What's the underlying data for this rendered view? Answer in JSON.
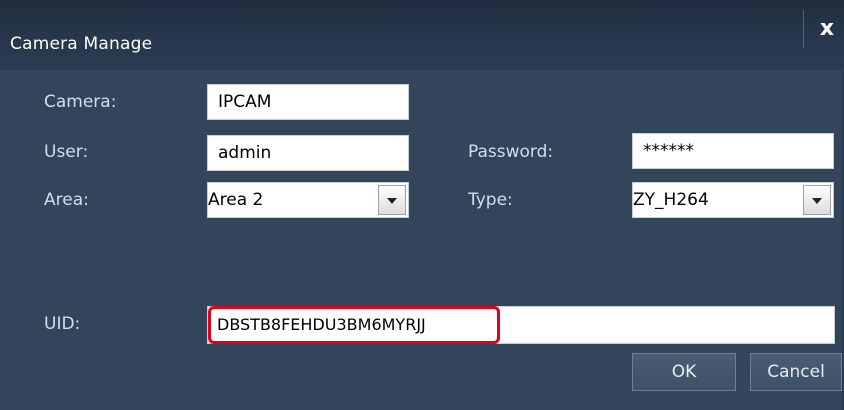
{
  "window": {
    "title": "Camera Manage",
    "close_glyph": "x"
  },
  "form": {
    "camera": {
      "label": "Camera:",
      "value": "IPCAM"
    },
    "user": {
      "label": "User:",
      "value": "admin"
    },
    "password": {
      "label": "Password:",
      "value": "******"
    },
    "area": {
      "label": "Area:",
      "value": "Area 2"
    },
    "type": {
      "label": "Type:",
      "value": "ZY_H264"
    },
    "uid": {
      "label": "UID:",
      "value": "DBSTB8FEHDU3BM6MYRJJ"
    }
  },
  "buttons": {
    "ok": "OK",
    "cancel": "Cancel"
  },
  "colors": {
    "dialog_bg": "#33455b",
    "highlight": "#e3001b"
  }
}
